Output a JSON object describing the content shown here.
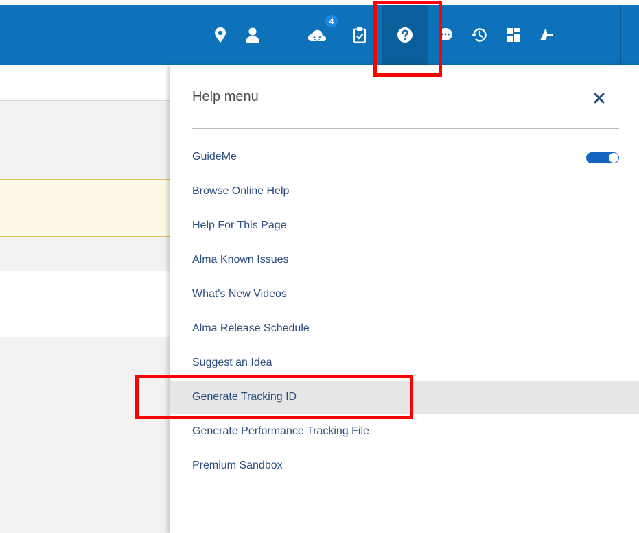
{
  "topbar": {
    "icons": [
      {
        "name": "location-icon"
      },
      {
        "name": "user-icon"
      },
      {
        "name": "cloud-notification-icon",
        "badge": "4"
      },
      {
        "name": "tasks-clipboard-icon"
      },
      {
        "name": "help-icon"
      },
      {
        "name": "chat-icon"
      },
      {
        "name": "history-icon"
      },
      {
        "name": "dashboard-grid-icon"
      },
      {
        "name": "plane-icon"
      }
    ],
    "color": "#0d72b9"
  },
  "help_menu": {
    "title": "Help menu",
    "close_icon": "close-icon",
    "items": [
      {
        "label": "GuideMe",
        "toggle_on": true
      },
      {
        "label": "Browse Online Help"
      },
      {
        "label": "Help For This Page"
      },
      {
        "label": "Alma Known Issues"
      },
      {
        "label": "What's New Videos"
      },
      {
        "label": "Alma Release Schedule"
      },
      {
        "label": "Suggest an Idea"
      },
      {
        "label": "Generate Tracking ID"
      },
      {
        "label": "Generate Performance Tracking File"
      },
      {
        "label": "Premium Sandbox"
      }
    ],
    "link_color": "#2a4d7d",
    "accent_color": "#1565c0"
  },
  "annotation_color": "#ff0000"
}
